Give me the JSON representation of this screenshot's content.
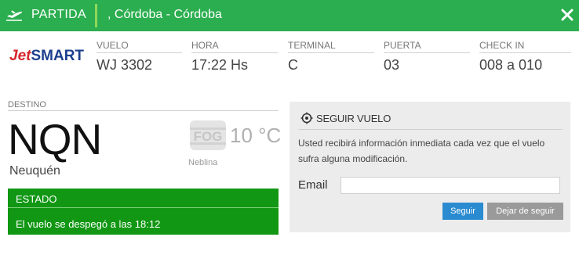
{
  "header": {
    "type_label": "PARTIDA",
    "route": ",  Córdoba - Córdoba",
    "icons": {
      "plane": "plane-departure-icon",
      "close": "close-icon"
    },
    "color": "#2bae4f"
  },
  "airline": {
    "logo_prefix": "Jet",
    "logo_suffix": "SMART"
  },
  "flight_info": [
    {
      "label": "VUELO",
      "value": "WJ 3302"
    },
    {
      "label": "HORA",
      "value": "17:22 Hs"
    },
    {
      "label": "TERMINAL",
      "value": "C"
    },
    {
      "label": "PUERTA",
      "value": "03"
    },
    {
      "label": "CHECK IN",
      "value": "008 a 010"
    }
  ],
  "destination": {
    "label": "DESTINO",
    "code": "NQN",
    "city": "Neuquén"
  },
  "weather": {
    "icon_text": "FOG",
    "temperature": "10 °C",
    "description": "Neblina",
    "icon": "fog-weather-icon"
  },
  "status": {
    "label": "ESTADO",
    "text": "El vuelo se despegó a las 18:12",
    "color": "#119714"
  },
  "follow": {
    "title": "SEGUIR VUELO",
    "icon": "target-icon",
    "description": "Usted recibirá información inmediata cada vez que el vuelo sufra alguna modificación.",
    "email_label": "Email",
    "email_value": "",
    "follow_button": "Seguir",
    "unfollow_button": "Dejar de seguir",
    "follow_color": "#2b8bd1"
  }
}
